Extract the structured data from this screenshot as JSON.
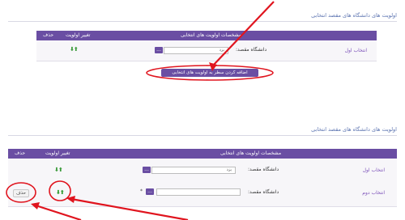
{
  "panel1": {
    "title": "اولویت های دانشگاه های مقصد انتخابی",
    "header": {
      "col_main": "مشخصات اولویت های انتخابی",
      "col_priority": "تغییر اولویت",
      "col_delete": "حذف"
    },
    "rows": [
      {
        "label": "انتخاب اول",
        "field_label": "دانشگاه مقصد:",
        "field_value": "یزد",
        "lookup_button": "...",
        "arrows": "⬇⬆"
      }
    ],
    "add_button": "اضافه کردن سطر به اولویت های انتخابی"
  },
  "panel2": {
    "title": "اولویت های دانشگاه های مقصد انتخابی",
    "header": {
      "col_main": "مشخصات اولویت های انتخابی",
      "col_priority": "تغییر اولویت",
      "col_delete": "حذف"
    },
    "rows": [
      {
        "label": "انتخاب اول",
        "field_label": "دانشگاه مقصد:",
        "field_value": "یزد",
        "lookup_button": "...",
        "arrows": "⬇⬆"
      },
      {
        "label": "انتخاب دوم",
        "field_label": "دانشگاه مقصد:",
        "field_value": "",
        "lookup_button": "...",
        "arrows": "⬇⬆",
        "required_mark": "*",
        "delete_button": "حذف"
      }
    ]
  },
  "colors": {
    "header": "#6a4ea3",
    "title": "#5b73b0",
    "annotation": "#e0141e",
    "arrows": "#3a9a3a"
  }
}
